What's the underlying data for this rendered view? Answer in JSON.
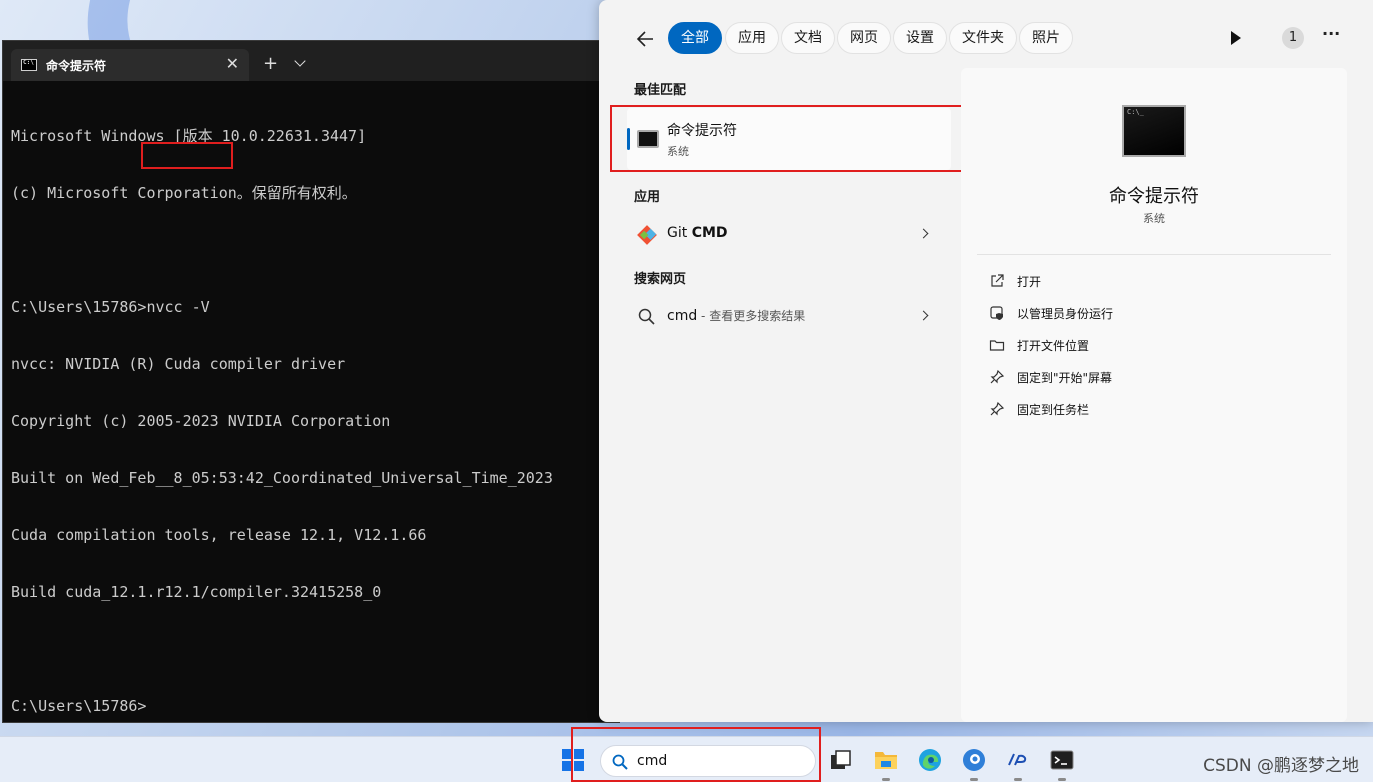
{
  "terminal": {
    "tab_title": "命令提示符",
    "tab_close": "✕",
    "new_tab": "+",
    "lines": [
      "Microsoft Windows [版本 10.0.22631.3447]",
      "(c) Microsoft Corporation。保留所有权利。",
      "",
      "C:\\Users\\15786>nvcc -V",
      "nvcc: NVIDIA (R) Cuda compiler driver",
      "Copyright (c) 2005-2023 NVIDIA Corporation",
      "Built on Wed_Feb__8_05:53:42_Coordinated_Universal_Time_2023",
      "Cuda compilation tools, release 12.1, V12.1.66",
      "Build cuda_12.1.r12.1/compiler.32415258_0",
      "",
      "C:\\Users\\15786>"
    ]
  },
  "search": {
    "filters": [
      "全部",
      "应用",
      "文档",
      "网页",
      "设置",
      "文件夹",
      "照片"
    ],
    "active_filter": "全部",
    "result_count": "1",
    "more": "···",
    "best_match_heading": "最佳匹配",
    "best_match": {
      "title": "命令提示符",
      "subtitle": "系统"
    },
    "apps_heading": "应用",
    "app_item": {
      "prefix": "Git ",
      "bold": "CMD"
    },
    "web_heading": "搜索网页",
    "web_item": {
      "query": "cmd",
      "hint": " - 查看更多搜索结果"
    },
    "detail": {
      "title": "命令提示符",
      "subtitle": "系统",
      "actions": [
        "打开",
        "以管理员身份运行",
        "打开文件位置",
        "固定到\"开始\"屏幕",
        "固定到任务栏"
      ]
    }
  },
  "taskbar": {
    "search_value": "cmd",
    "apps": [
      "task-view",
      "file-explorer",
      "edge",
      "edge-dev",
      "hp-app",
      "terminal"
    ]
  },
  "watermark": "CSDN @鹏逐梦之地",
  "colors": {
    "accent": "#0067c0",
    "highlight_box": "#e01e1e",
    "terminal_bg": "#0c0c0c"
  }
}
